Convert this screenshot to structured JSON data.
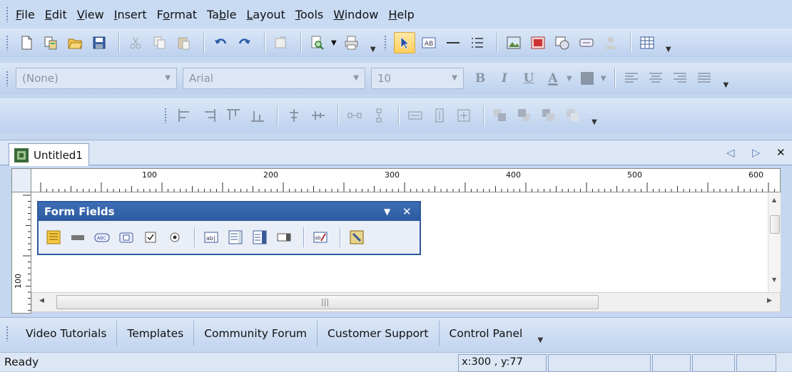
{
  "menu": {
    "items": [
      {
        "pre": "",
        "u": "F",
        "post": "ile"
      },
      {
        "pre": "",
        "u": "E",
        "post": "dit"
      },
      {
        "pre": "",
        "u": "V",
        "post": "iew"
      },
      {
        "pre": "",
        "u": "I",
        "post": "nsert"
      },
      {
        "pre": "F",
        "u": "o",
        "post": "rmat"
      },
      {
        "pre": "Ta",
        "u": "b",
        "post": "le"
      },
      {
        "pre": "",
        "u": "L",
        "post": "ayout"
      },
      {
        "pre": "",
        "u": "T",
        "post": "ools"
      },
      {
        "pre": "",
        "u": "W",
        "post": "indow"
      },
      {
        "pre": "",
        "u": "H",
        "post": "elp"
      }
    ]
  },
  "format_toolbar": {
    "style_value": "(None)",
    "font_value": "Arial",
    "size_value": "10",
    "bold": "B",
    "italic": "I",
    "underline": "U",
    "font_color": "A"
  },
  "document": {
    "tab_title": "Untitled1"
  },
  "ruler": {
    "labels": [
      "100",
      "200",
      "300",
      "400",
      "500",
      "600"
    ],
    "vlabel": "100"
  },
  "form_fields": {
    "title": "Form Fields"
  },
  "bottom_tabs": [
    "Video Tutorials",
    "Templates",
    "Community Forum",
    "Customer Support",
    "Control Panel"
  ],
  "status": {
    "text": "Ready",
    "coords": "x:300 , y:77"
  },
  "colors": {
    "toolbar_bg": "#c9dbf3",
    "form_title": "#2c5aa0",
    "active_tool": "#ffcf5a"
  }
}
